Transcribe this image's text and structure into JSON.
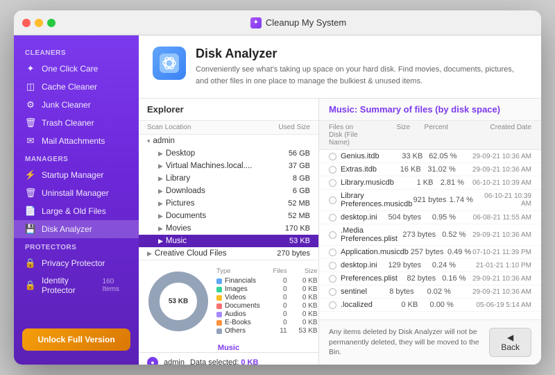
{
  "window": {
    "title": "Cleanup My System"
  },
  "sidebar": {
    "sections": [
      {
        "label": "Cleaners",
        "items": [
          {
            "id": "one-click-care",
            "label": "One Click Care",
            "icon": "✦"
          },
          {
            "id": "cache-cleaner",
            "label": "Cache Cleaner",
            "icon": "🗂"
          },
          {
            "id": "junk-cleaner",
            "label": "Junk Cleaner",
            "icon": "🗑"
          },
          {
            "id": "trash-cleaner",
            "label": "Trash Cleaner",
            "icon": "🗑"
          },
          {
            "id": "mail-attachments",
            "label": "Mail Attachments",
            "icon": "✉"
          }
        ]
      },
      {
        "label": "Managers",
        "items": [
          {
            "id": "startup-manager",
            "label": "Startup Manager",
            "icon": "⚡"
          },
          {
            "id": "uninstall-manager",
            "label": "Uninstall Manager",
            "icon": "🗑"
          },
          {
            "id": "large-old-files",
            "label": "Large & Old Files",
            "icon": "📄"
          },
          {
            "id": "disk-analyzer",
            "label": "Disk Analyzer",
            "icon": "💾",
            "active": true
          }
        ]
      },
      {
        "label": "Protectors",
        "items": [
          {
            "id": "privacy-protector",
            "label": "Privacy Protector",
            "icon": "🔒"
          },
          {
            "id": "identity-protector",
            "label": "Identity Protector",
            "icon": "🔒",
            "badge": "160 Items"
          }
        ]
      }
    ],
    "unlock_label": "Unlock Full Version"
  },
  "app_header": {
    "title": "Disk Analyzer",
    "description": "Conveniently see what's taking up space on your hard disk. Find movies, documents, pictures, and other files in one place to manage the bulkiest & unused items."
  },
  "explorer": {
    "title": "Explorer",
    "columns": [
      "Scan Location",
      "Used Size"
    ],
    "tree": [
      {
        "level": 0,
        "label": "admin",
        "size": "",
        "expanded": true,
        "arrow": "▾"
      },
      {
        "level": 1,
        "label": "Desktop",
        "size": "56 GB",
        "expanded": false,
        "arrow": "▶"
      },
      {
        "level": 1,
        "label": "Virtual Machines.local....",
        "size": "37 GB",
        "expanded": false,
        "arrow": "▶"
      },
      {
        "level": 1,
        "label": "Library",
        "size": "8 GB",
        "expanded": false,
        "arrow": "▶"
      },
      {
        "level": 1,
        "label": "Downloads",
        "size": "6 GB",
        "expanded": false,
        "arrow": "▶"
      },
      {
        "level": 1,
        "label": "Pictures",
        "size": "52 MB",
        "expanded": false,
        "arrow": "▶"
      },
      {
        "level": 1,
        "label": "Documents",
        "size": "52 MB",
        "expanded": false,
        "arrow": "▶"
      },
      {
        "level": 1,
        "label": "Movies",
        "size": "170 KB",
        "expanded": false,
        "arrow": "▶"
      },
      {
        "level": 1,
        "label": "Music",
        "size": "53 KB",
        "expanded": false,
        "arrow": "▶",
        "active": true
      },
      {
        "level": 0,
        "label": "Creative Cloud Files",
        "size": "270 bytes",
        "expanded": false,
        "arrow": "▶"
      }
    ]
  },
  "donut": {
    "center_label": "53 KB",
    "bottom_label": "Music",
    "legend_headers": [
      "Type",
      "Files",
      "Size"
    ],
    "legend_rows": [
      {
        "type": "Financials",
        "color": "#60a5fa",
        "files": "0",
        "size": "0 KB"
      },
      {
        "type": "Images",
        "color": "#34d399",
        "files": "0",
        "size": "0 KB"
      },
      {
        "type": "Videos",
        "color": "#fbbf24",
        "files": "0",
        "size": "0 KB"
      },
      {
        "type": "Documents",
        "color": "#f87171",
        "files": "0",
        "size": "0 KB"
      },
      {
        "type": "Audios",
        "color": "#a78bfa",
        "files": "0",
        "size": "0 KB"
      },
      {
        "type": "E-Books",
        "color": "#fb923c",
        "files": "0",
        "size": "0 KB"
      },
      {
        "type": "Others",
        "color": "#94a3b8",
        "files": "11",
        "size": "53 KB"
      }
    ]
  },
  "status_bar": {
    "user": "admin",
    "label": "Data selected:",
    "value": "0 KB"
  },
  "files_panel": {
    "header_prefix": "Music:",
    "header_suffix": "Summary of files (by disk space)",
    "columns": [
      "Files on Disk (File Name)",
      "Size",
      "Percent",
      "Created Date"
    ],
    "rows": [
      {
        "name": "Genius.itdb",
        "size": "33 KB",
        "percent": "62.05 %",
        "date": "29-09-21 10:36 AM"
      },
      {
        "name": "Extras.itdb",
        "size": "16 KB",
        "percent": "31.02 %",
        "date": "29-09-21 10:36 AM"
      },
      {
        "name": "Library.musicdb",
        "size": "1 KB",
        "percent": "2.81 %",
        "date": "06-10-21 10:39 AM"
      },
      {
        "name": "Library Preferences.musicdb",
        "size": "921 bytes",
        "percent": "1.74 %",
        "date": "06-10-21 10:39 AM"
      },
      {
        "name": "desktop.ini",
        "size": "504 bytes",
        "percent": "0.95 %",
        "date": "06-08-21 11:55 AM"
      },
      {
        "name": ".Media Preferences.plist",
        "size": "273 bytes",
        "percent": "0.52 %",
        "date": "29-09-21 10:36 AM"
      },
      {
        "name": "Application.musicdb",
        "size": "257 bytes",
        "percent": "0.49 %",
        "date": "07-10-21 11:39 PM"
      },
      {
        "name": "desktop.ini",
        "size": "129 bytes",
        "percent": "0.24 %",
        "date": "21-01-21 1:10 PM"
      },
      {
        "name": "Preferences.plist",
        "size": "82 bytes",
        "percent": "0.16 %",
        "date": "29-09-21 10:36 AM"
      },
      {
        "name": "sentinel",
        "size": "8 bytes",
        "percent": "0.02 %",
        "date": "29-09-21 10:36 AM"
      },
      {
        "name": ".localized",
        "size": "0 KB",
        "percent": "0.00 %",
        "date": "05-06-19 5:14 AM"
      }
    ],
    "footer_note": "Any items deleted by Disk Analyzer will not be permanently deleted, they will be moved to the Bin.",
    "back_button": "◀ Back"
  }
}
